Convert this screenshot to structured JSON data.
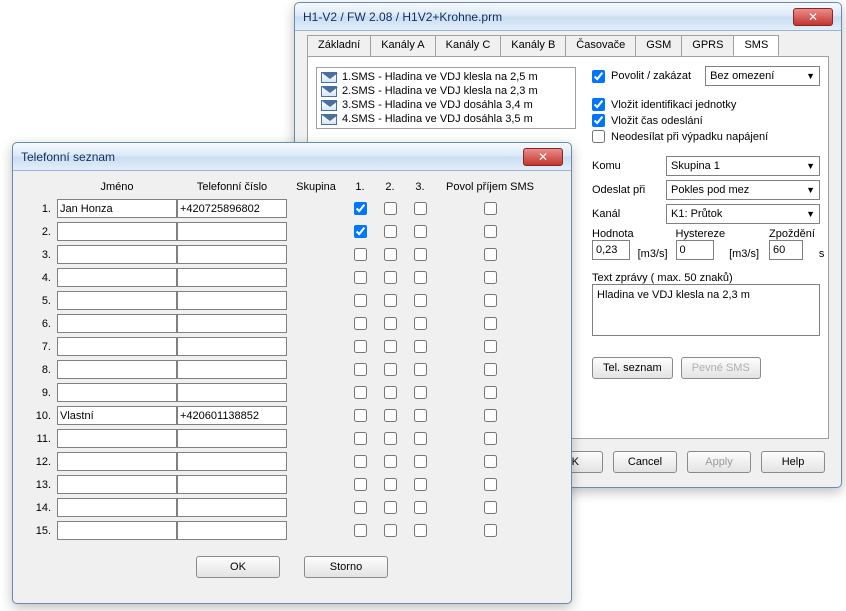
{
  "main": {
    "title": "H1-V2 / FW 2.08 / H1V2+Krohne.prm",
    "close_glyph": "✕",
    "tabs": [
      "Základní",
      "Kanály A",
      "Kanály C",
      "Kanály B",
      "Časovače",
      "GSM",
      "GPRS",
      "SMS"
    ],
    "active_tab": 7,
    "sms_items": [
      "1.SMS - Hladina ve VDJ klesla na 2,5 m",
      "2.SMS - Hladina ve VDJ klesla na 2,3 m",
      "3.SMS - Hladina ve VDJ  dosáhla 3,4 m",
      "4.SMS - Hladina ve VDJ dosáhla 3,5 m"
    ],
    "chk_enable": "Povolit / zakázat",
    "sel_limit": "Bez omezení",
    "chk_ident": "Vložit identifikaci jednotky",
    "chk_time": "Vložit čas odeslání",
    "chk_nopower": "Neodesílat při výpadku napájení",
    "lbl_komu": "Komu",
    "val_komu": "Skupina 1",
    "lbl_odeslat": "Odeslat při",
    "val_odeslat": "Pokles pod mez",
    "lbl_kanal": "Kanál",
    "val_kanal": "K1: Průtok",
    "lbl_hodnota": "Hodnota",
    "val_hodnota": "0,23",
    "unit_hodnota": "[m3/s]",
    "lbl_hystereze": "Hystereze",
    "val_hystereze": "0",
    "unit_hystereze": "[m3/s]",
    "lbl_zpozdeni": "Zpoždění",
    "val_zpozdeni": "60",
    "unit_zpozdeni": "s",
    "lbl_text": "Text zprávy ( max. 50 znaků)",
    "val_text": "Hladina ve VDJ klesla na 2,3 m",
    "btn_tel": "Tel. seznam",
    "btn_pevne": "Pevné SMS",
    "btn_ok": "OK",
    "btn_cancel": "Cancel",
    "btn_apply": "Apply",
    "btn_help": "Help"
  },
  "tel": {
    "title": "Telefonní seznam",
    "close_glyph": "✕",
    "hdr_jmeno": "Jméno",
    "hdr_cislo": "Telefonní číslo",
    "hdr_skupina": "Skupina",
    "hdr_g1": "1.",
    "hdr_g2": "2.",
    "hdr_g3": "3.",
    "hdr_povol": "Povol příjem SMS",
    "rows": [
      {
        "n": "1.",
        "jm": "Jan Honza",
        "tc": "+420725896802",
        "g1": true,
        "g2": false,
        "g3": false,
        "p": false
      },
      {
        "n": "2.",
        "jm": "",
        "tc": "",
        "g1": true,
        "g2": false,
        "g3": false,
        "p": false
      },
      {
        "n": "3.",
        "jm": "",
        "tc": "",
        "g1": false,
        "g2": false,
        "g3": false,
        "p": false
      },
      {
        "n": "4.",
        "jm": "",
        "tc": "",
        "g1": false,
        "g2": false,
        "g3": false,
        "p": false
      },
      {
        "n": "5.",
        "jm": "",
        "tc": "",
        "g1": false,
        "g2": false,
        "g3": false,
        "p": false
      },
      {
        "n": "6.",
        "jm": "",
        "tc": "",
        "g1": false,
        "g2": false,
        "g3": false,
        "p": false
      },
      {
        "n": "7.",
        "jm": "",
        "tc": "",
        "g1": false,
        "g2": false,
        "g3": false,
        "p": false
      },
      {
        "n": "8.",
        "jm": "",
        "tc": "",
        "g1": false,
        "g2": false,
        "g3": false,
        "p": false
      },
      {
        "n": "9.",
        "jm": "",
        "tc": "",
        "g1": false,
        "g2": false,
        "g3": false,
        "p": false
      },
      {
        "n": "10.",
        "jm": "Vlastní",
        "tc": "+420601138852",
        "g1": false,
        "g2": false,
        "g3": false,
        "p": false
      },
      {
        "n": "11.",
        "jm": "",
        "tc": "",
        "g1": false,
        "g2": false,
        "g3": false,
        "p": false
      },
      {
        "n": "12.",
        "jm": "",
        "tc": "",
        "g1": false,
        "g2": false,
        "g3": false,
        "p": false
      },
      {
        "n": "13.",
        "jm": "",
        "tc": "",
        "g1": false,
        "g2": false,
        "g3": false,
        "p": false
      },
      {
        "n": "14.",
        "jm": "",
        "tc": "",
        "g1": false,
        "g2": false,
        "g3": false,
        "p": false
      },
      {
        "n": "15.",
        "jm": "",
        "tc": "",
        "g1": false,
        "g2": false,
        "g3": false,
        "p": false
      }
    ],
    "btn_ok": "OK",
    "btn_storno": "Storno"
  }
}
